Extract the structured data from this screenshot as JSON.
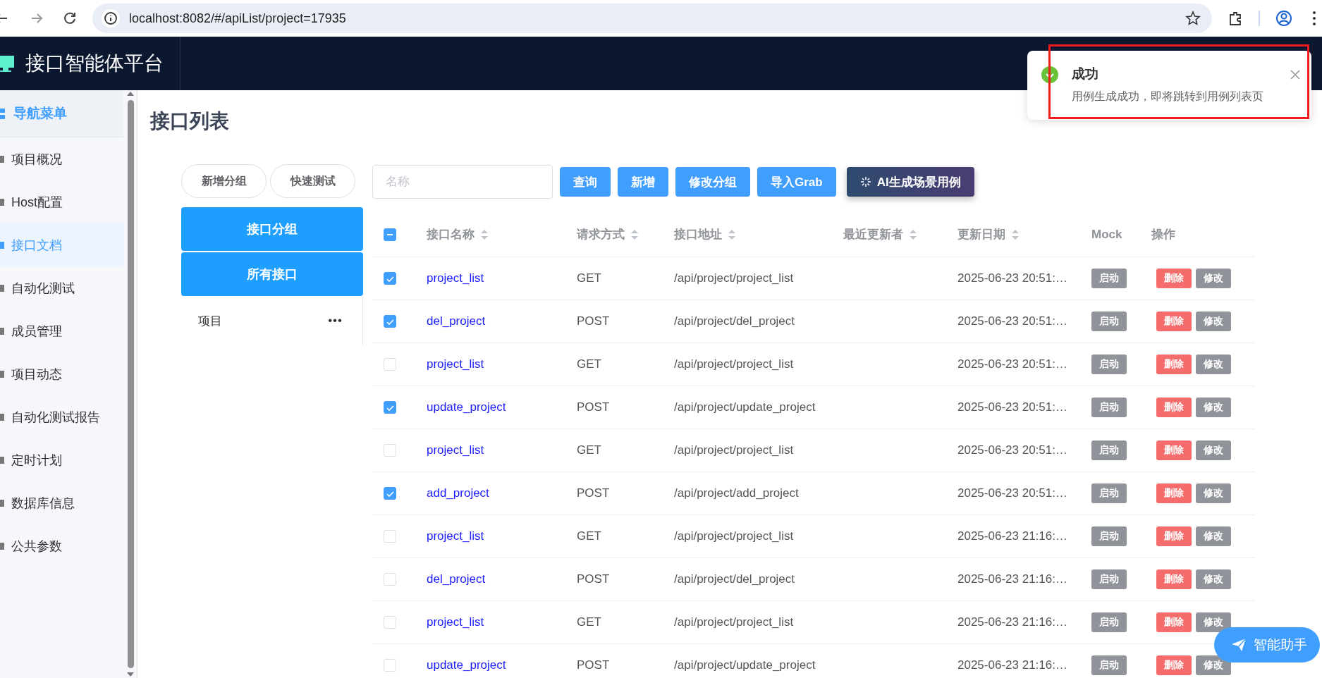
{
  "browser": {
    "url": "localhost:8082/#/apiList/project=17935"
  },
  "header": {
    "title": "接口智能体平台"
  },
  "sidebar": {
    "heading": "导航菜单",
    "items": [
      {
        "label": "项目概况",
        "selected": false
      },
      {
        "label": "Host配置",
        "selected": false
      },
      {
        "label": "接口文档",
        "selected": true
      },
      {
        "label": "自动化测试",
        "selected": false
      },
      {
        "label": "成员管理",
        "selected": false
      },
      {
        "label": "项目动态",
        "selected": false
      },
      {
        "label": "自动化测试报告",
        "selected": false
      },
      {
        "label": "定时计划",
        "selected": false
      },
      {
        "label": "数据库信息",
        "selected": false
      },
      {
        "label": "公共参数",
        "selected": false
      }
    ]
  },
  "page": {
    "title": "接口列表"
  },
  "group_panel": {
    "buttons": [
      "新增分组",
      "快速测试"
    ],
    "tabs": [
      {
        "label": "接口分组"
      },
      {
        "label": "所有接口"
      }
    ],
    "groups": [
      {
        "label": "项目",
        "more": "•••"
      }
    ]
  },
  "toolbar": {
    "search": {
      "placeholder": "名称"
    },
    "buttons": [
      {
        "label": "查询",
        "kind": "primary"
      },
      {
        "label": "新增",
        "kind": "primary"
      },
      {
        "label": "修改分组",
        "kind": "primary"
      },
      {
        "label": "导入Grab",
        "kind": "primary"
      },
      {
        "label": "AI生成场景用例",
        "kind": "ai"
      }
    ]
  },
  "table": {
    "select_all": {
      "indeterminate": true
    },
    "columns": [
      {
        "label": "接口名称",
        "sortable": true
      },
      {
        "label": "请求方式",
        "sortable": true
      },
      {
        "label": "接口地址",
        "sortable": true
      },
      {
        "label": "最近更新者",
        "sortable": true
      },
      {
        "label": "更新日期",
        "sortable": true
      },
      {
        "label": "Mock",
        "sortable": false
      },
      {
        "label": "操作",
        "sortable": false
      }
    ],
    "rows": [
      {
        "checked": true,
        "name": "project_list",
        "method": "GET",
        "path": "/api/project/project_list",
        "updater": "",
        "date": "2025-06-23 20:51:…",
        "mock": "启动",
        "actions": [
          "删除",
          "修改"
        ]
      },
      {
        "checked": true,
        "name": "del_project",
        "method": "POST",
        "path": "/api/project/del_project",
        "updater": "",
        "date": "2025-06-23 20:51:…",
        "mock": "启动",
        "actions": [
          "删除",
          "修改"
        ]
      },
      {
        "checked": false,
        "name": "project_list",
        "method": "GET",
        "path": "/api/project/project_list",
        "updater": "",
        "date": "2025-06-23 20:51:…",
        "mock": "启动",
        "actions": [
          "删除",
          "修改"
        ]
      },
      {
        "checked": true,
        "name": "update_project",
        "method": "POST",
        "path": "/api/project/update_project",
        "updater": "",
        "date": "2025-06-23 20:51:…",
        "mock": "启动",
        "actions": [
          "删除",
          "修改"
        ]
      },
      {
        "checked": false,
        "name": "project_list",
        "method": "GET",
        "path": "/api/project/project_list",
        "updater": "",
        "date": "2025-06-23 20:51:…",
        "mock": "启动",
        "actions": [
          "删除",
          "修改"
        ]
      },
      {
        "checked": true,
        "name": "add_project",
        "method": "POST",
        "path": "/api/project/add_project",
        "updater": "",
        "date": "2025-06-23 20:51:…",
        "mock": "启动",
        "actions": [
          "删除",
          "修改"
        ]
      },
      {
        "checked": false,
        "name": "project_list",
        "method": "GET",
        "path": "/api/project/project_list",
        "updater": "",
        "date": "2025-06-23 21:16:…",
        "mock": "启动",
        "actions": [
          "删除",
          "修改"
        ]
      },
      {
        "checked": false,
        "name": "del_project",
        "method": "POST",
        "path": "/api/project/del_project",
        "updater": "",
        "date": "2025-06-23 21:16:…",
        "mock": "启动",
        "actions": [
          "删除",
          "修改"
        ]
      },
      {
        "checked": false,
        "name": "project_list",
        "method": "GET",
        "path": "/api/project/project_list",
        "updater": "",
        "date": "2025-06-23 21:16:…",
        "mock": "启动",
        "actions": [
          "删除",
          "修改"
        ]
      },
      {
        "checked": false,
        "name": "update_project",
        "method": "POST",
        "path": "/api/project/update_project",
        "updater": "",
        "date": "2025-06-23 21:16:…",
        "mock": "启动",
        "actions": [
          "删除",
          "修改"
        ]
      }
    ]
  },
  "notification": {
    "kind": "success",
    "title": "成功",
    "message": "用例生成成功，即将跳转到用例列表页",
    "highlighted": true
  },
  "assistant": {
    "label": "智能助手"
  }
}
